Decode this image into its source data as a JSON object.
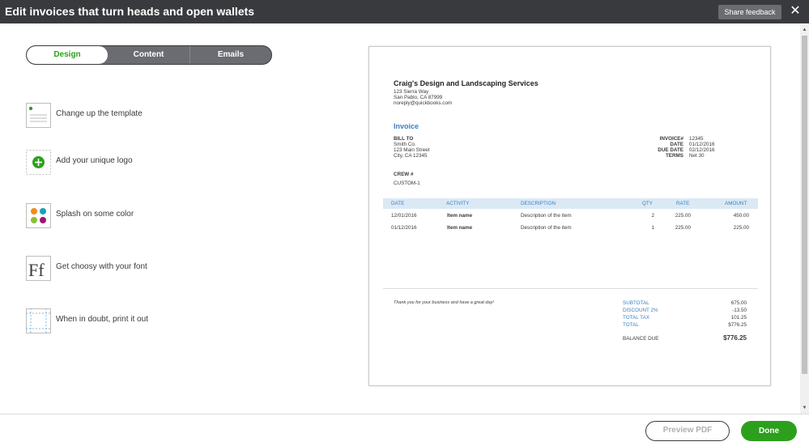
{
  "titlebar": {
    "title": "Edit invoices that turn heads and open wallets",
    "share_label": "Share feedback",
    "close_symbol": "✕"
  },
  "tabs": [
    {
      "label": "Design",
      "active": true
    },
    {
      "label": "Content",
      "active": false
    },
    {
      "label": "Emails",
      "active": false
    }
  ],
  "options": [
    {
      "label": "Change up the template",
      "icon": "template-icon"
    },
    {
      "label": "Add your unique logo",
      "icon": "add-logo-icon"
    },
    {
      "label": "Splash on some color",
      "icon": "color-palette-icon"
    },
    {
      "label": "Get choosy with your font",
      "icon": "font-icon"
    },
    {
      "label": "When in doubt, print it out",
      "icon": "print-margins-icon"
    }
  ],
  "colors": {
    "accent_green": "#2ca01c",
    "titlebar_bg": "#393a3d",
    "invoice_blue": "#3d7ebf"
  },
  "footer": {
    "preview_label": "Preview PDF",
    "done_label": "Done"
  },
  "invoice": {
    "company": "Craig's Design and Landscaping Services",
    "address1": "123 Sierra Way",
    "address2": "San Pablo, CA 87999",
    "email": "noreply@quickbooks.com",
    "title": "Invoice",
    "bill_to_label": "BILL TO",
    "bill_to": [
      "Smith Co.",
      "123 Main Street",
      "City, CA 12345"
    ],
    "meta": [
      {
        "label": "INVOICE#",
        "value": "12345"
      },
      {
        "label": "DATE",
        "value": "01/12/2016"
      },
      {
        "label": "DUE DATE",
        "value": "02/12/2016"
      },
      {
        "label": "TERMS",
        "value": "Net 30"
      }
    ],
    "crew_label": "CREW #",
    "crew_value": "CUSTOM-1",
    "columns": [
      "DATE",
      "ACTIVITY",
      "DESCRIPTION",
      "QTY",
      "RATE",
      "AMOUNT"
    ],
    "rows": [
      {
        "date": "12/01/2016",
        "activity": "Item name",
        "description": "Description of the item",
        "qty": "2",
        "rate": "225.00",
        "amount": "450.00"
      },
      {
        "date": "01/12/2016",
        "activity": "Item name",
        "description": "Description of the item",
        "qty": "1",
        "rate": "225.00",
        "amount": "225.00"
      }
    ],
    "message": "Thank you for your business and have a great day!",
    "totals": [
      {
        "label": "SUBTOTAL",
        "value": "675.00"
      },
      {
        "label": "DISCOUNT 2%",
        "value": "-13.50"
      },
      {
        "label": "TOTAL TAX",
        "value": "101.25"
      },
      {
        "label": "TOTAL",
        "value": "$776.25"
      }
    ],
    "balance_label": "BALANCE DUE",
    "balance_value": "$776.25"
  }
}
